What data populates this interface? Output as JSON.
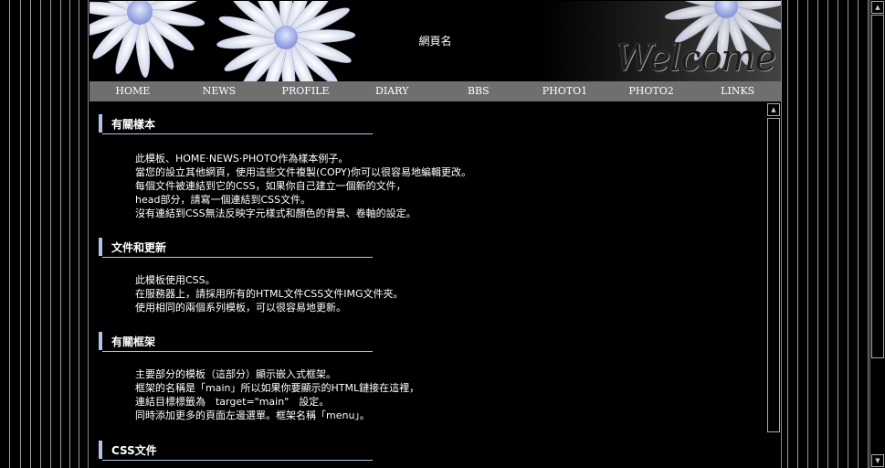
{
  "banner": {
    "title": "網頁名",
    "welcome": "Welcome"
  },
  "nav": {
    "items": [
      {
        "label": "HOME"
      },
      {
        "label": "NEWS"
      },
      {
        "label": "PROFILE"
      },
      {
        "label": "DIARY"
      },
      {
        "label": "BBS"
      },
      {
        "label": "PHOTO1"
      },
      {
        "label": "PHOTO2"
      },
      {
        "label": "LINKS"
      }
    ]
  },
  "sections": [
    {
      "title": "有關樣本",
      "lines": [
        "此模板、HOME‧NEWS‧PHOTO作為樣本例子。",
        "當您的設立其他網頁，使用這些文件複製(COPY)你可以很容易地編輯更改。",
        "每個文件被連結到它的CSS，如果你自己建立一個新的文件，",
        "head部分，請寫一個連結到CSS文件。",
        "沒有連結到CSS無法反映字元樣式和顏色的背景、卷軸的設定。"
      ]
    },
    {
      "title": "文件和更新",
      "lines": [
        "此模板使用CSS。",
        "在服務器上，請採用所有的HTML文件CSS文件IMG文件夾。",
        "使用相同的兩個系列模板，可以很容易地更新。"
      ]
    },
    {
      "title": "有關框架",
      "lines": [
        "主要部分的模板（這部分）顯示嵌入式框架。",
        "框架的名稱是「main」所以如果你要顯示的HTML鏈接在這裡，",
        "連結目標標籤為　target=\"main\"　設定。",
        "同時添加更多的頁面左邊選單。框架名稱「menu」。"
      ]
    },
    {
      "title": "CSS文件",
      "lines": []
    }
  ],
  "colors": {
    "accent": "#aec4e6",
    "nav_bg": "#6f6f6f",
    "background": "#000000"
  }
}
